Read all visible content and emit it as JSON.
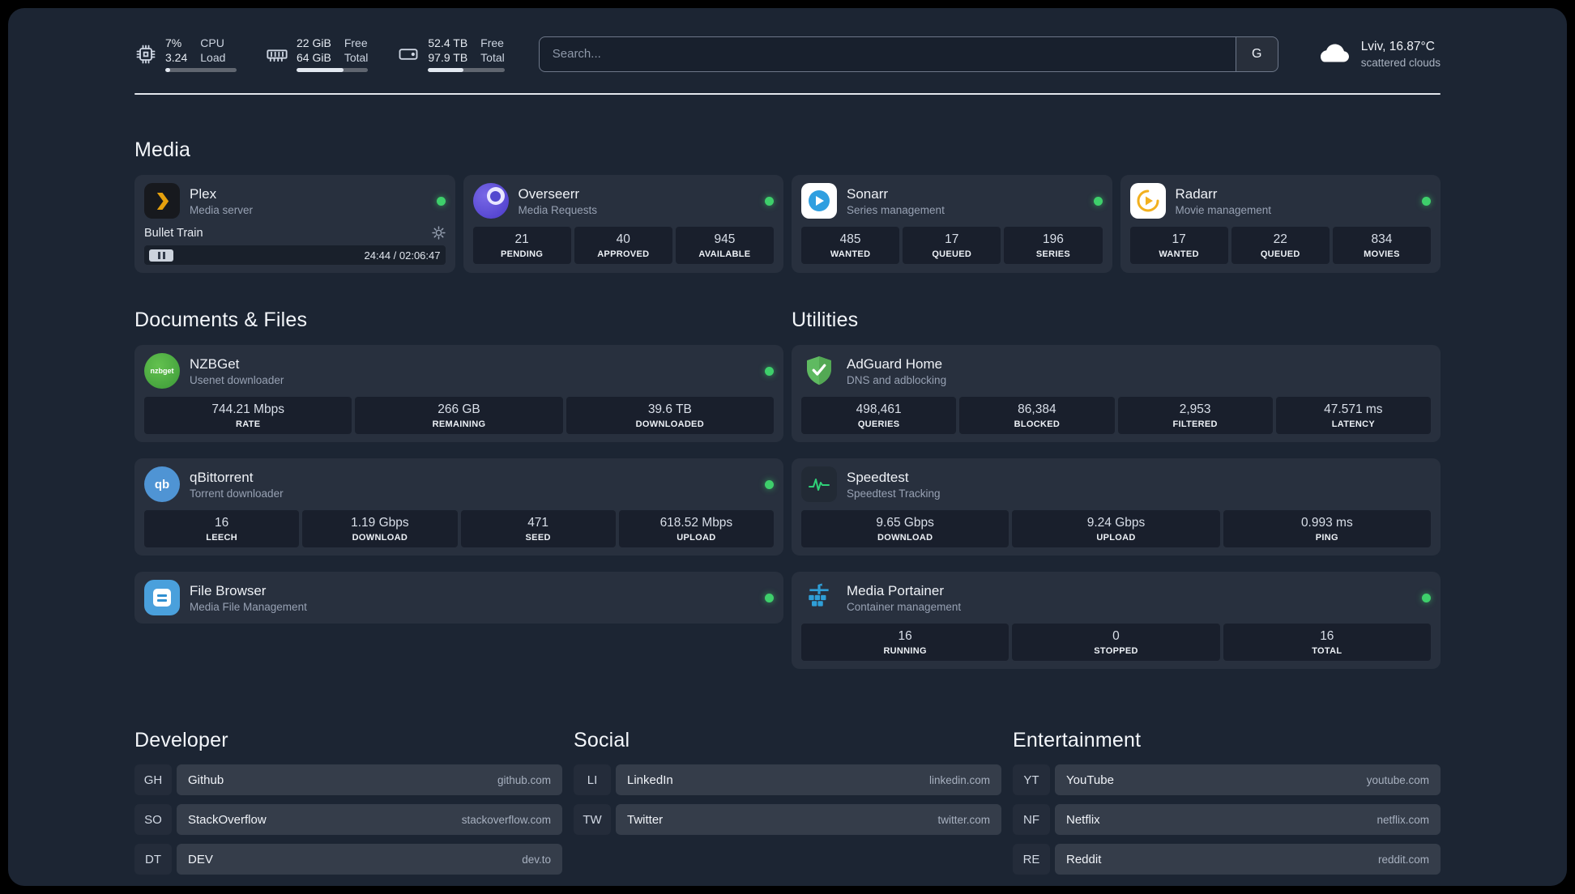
{
  "colors": {
    "background": "#1c2533",
    "card": "#2a3342",
    "status_green": "#3ecf6b",
    "plex_amber": "#e5a00d",
    "sonarr_blue": "#2f9fe0",
    "radarr_amber": "#f2b01e",
    "adguard_green": "#5fba61",
    "speedtest_green": "#2fd077",
    "portainer_blue": "#2f9fd8"
  },
  "header": {
    "cpu": {
      "value1": "7%",
      "value2": "3.24",
      "label1": "CPU",
      "label2": "Load",
      "icon": "cpu-icon"
    },
    "memory": {
      "value1": "22 GiB",
      "value2": "64 GiB",
      "label1": "Free",
      "label2": "Total",
      "icon": "memory-icon"
    },
    "disk": {
      "value1": "52.4 TB",
      "value2": "97.9 TB",
      "label1": "Free",
      "label2": "Total",
      "icon": "disk-icon"
    },
    "search": {
      "placeholder": "Search...",
      "button": "G"
    },
    "weather": {
      "location": "Lviv, 16.87°C",
      "condition": "scattered clouds",
      "icon": "cloud-icon"
    }
  },
  "sections": {
    "media": {
      "title": "Media",
      "cards": [
        {
          "name": "Plex",
          "desc": "Media server",
          "icon": "plex-icon",
          "status": "online",
          "player": {
            "title": "Bullet Train",
            "time": "24:44 / 02:06:47",
            "state": "paused"
          }
        },
        {
          "name": "Overseerr",
          "desc": "Media Requests",
          "icon": "overseerr-icon",
          "status": "online",
          "stats": [
            {
              "value": "21",
              "label": "PENDING"
            },
            {
              "value": "40",
              "label": "APPROVED"
            },
            {
              "value": "945",
              "label": "AVAILABLE"
            }
          ]
        },
        {
          "name": "Sonarr",
          "desc": "Series management",
          "icon": "sonarr-icon",
          "status": "online",
          "stats": [
            {
              "value": "485",
              "label": "WANTED"
            },
            {
              "value": "17",
              "label": "QUEUED"
            },
            {
              "value": "196",
              "label": "SERIES"
            }
          ]
        },
        {
          "name": "Radarr",
          "desc": "Movie management",
          "icon": "radarr-icon",
          "status": "online",
          "stats": [
            {
              "value": "17",
              "label": "WANTED"
            },
            {
              "value": "22",
              "label": "QUEUED"
            },
            {
              "value": "834",
              "label": "MOVIES"
            }
          ]
        }
      ]
    },
    "files": {
      "title": "Documents & Files",
      "cards": [
        {
          "name": "NZBGet",
          "desc": "Usenet downloader",
          "icon": "nzbget-icon",
          "status": "online",
          "stats": [
            {
              "value": "744.21 Mbps",
              "label": "RATE"
            },
            {
              "value": "266 GB",
              "label": "REMAINING"
            },
            {
              "value": "39.6 TB",
              "label": "DOWNLOADED"
            }
          ]
        },
        {
          "name": "qBittorrent",
          "desc": "Torrent downloader",
          "icon": "qbittorrent-icon",
          "status": "online",
          "stats": [
            {
              "value": "16",
              "label": "LEECH"
            },
            {
              "value": "1.19 Gbps",
              "label": "DOWNLOAD"
            },
            {
              "value": "471",
              "label": "SEED"
            },
            {
              "value": "618.52 Mbps",
              "label": "UPLOAD"
            }
          ]
        },
        {
          "name": "File Browser",
          "desc": "Media File Management",
          "icon": "filebrowser-icon",
          "status": "online",
          "stats": []
        }
      ]
    },
    "utilities": {
      "title": "Utilities",
      "cards": [
        {
          "name": "AdGuard Home",
          "desc": "DNS and adblocking",
          "icon": "adguard-icon",
          "stats": [
            {
              "value": "498,461",
              "label": "QUERIES"
            },
            {
              "value": "86,384",
              "label": "BLOCKED"
            },
            {
              "value": "2,953",
              "label": "FILTERED"
            },
            {
              "value": "47.571 ms",
              "label": "LATENCY"
            }
          ]
        },
        {
          "name": "Speedtest",
          "desc": "Speedtest Tracking",
          "icon": "speedtest-icon",
          "stats": [
            {
              "value": "9.65 Gbps",
              "label": "DOWNLOAD"
            },
            {
              "value": "9.24 Gbps",
              "label": "UPLOAD"
            },
            {
              "value": "0.993 ms",
              "label": "PING"
            }
          ]
        },
        {
          "name": "Media Portainer",
          "desc": "Container management",
          "icon": "portainer-icon",
          "status": "online",
          "stats": [
            {
              "value": "16",
              "label": "RUNNING"
            },
            {
              "value": "0",
              "label": "STOPPED"
            },
            {
              "value": "16",
              "label": "TOTAL"
            }
          ]
        }
      ]
    }
  },
  "bookmarks": {
    "groups": [
      {
        "title": "Developer",
        "items": [
          {
            "abbr": "GH",
            "name": "Github",
            "url": "github.com"
          },
          {
            "abbr": "SO",
            "name": "StackOverflow",
            "url": "stackoverflow.com"
          },
          {
            "abbr": "DT",
            "name": "DEV",
            "url": "dev.to"
          }
        ]
      },
      {
        "title": "Social",
        "items": [
          {
            "abbr": "LI",
            "name": "LinkedIn",
            "url": "linkedin.com"
          },
          {
            "abbr": "TW",
            "name": "Twitter",
            "url": "twitter.com"
          }
        ]
      },
      {
        "title": "Entertainment",
        "items": [
          {
            "abbr": "YT",
            "name": "YouTube",
            "url": "youtube.com"
          },
          {
            "abbr": "NF",
            "name": "Netflix",
            "url": "netflix.com"
          },
          {
            "abbr": "RE",
            "name": "Reddit",
            "url": "reddit.com"
          }
        ]
      }
    ]
  }
}
